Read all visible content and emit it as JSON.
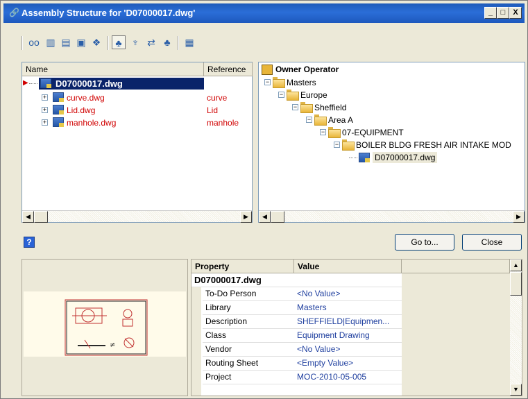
{
  "window": {
    "title": "Assembly Structure for 'D07000017.dwg'",
    "min_label": "_",
    "max_label": "□",
    "close_label": "X"
  },
  "toolbar": {
    "icons": [
      "glasses-icon",
      "columns-icon",
      "copy-icon",
      "export-icon",
      "link-icon",
      "tree-icon",
      "filter-icon",
      "compare-icon",
      "hierarchy-icon",
      "properties-icon"
    ],
    "glyphs": [
      "oo",
      "▥",
      "▤",
      "▣",
      "❖",
      "♣",
      "♆",
      "⇄",
      "♣",
      "▦"
    ]
  },
  "assembly": {
    "columns": {
      "name": "Name",
      "reference": "Reference"
    },
    "root": {
      "name": "D07000017.dwg",
      "reference": ""
    },
    "children": [
      {
        "name": "curve.dwg",
        "reference": "curve"
      },
      {
        "name": "Lid.dwg",
        "reference": "Lid"
      },
      {
        "name": "manhole.dwg",
        "reference": "manhole"
      }
    ],
    "child_color": "#d00000"
  },
  "tree": {
    "root": "Owner Operator",
    "nodes": [
      "Masters",
      "Europe",
      "Sheffield",
      "Area A",
      "07-EQUIPMENT",
      "BOILER BLDG FRESH AIR INTAKE MOD",
      "D07000017.dwg"
    ]
  },
  "buttons": {
    "goto": "Go to...",
    "close": "Close",
    "help": "?"
  },
  "properties": {
    "header": {
      "property": "Property",
      "value": "Value"
    },
    "group": "D07000017.dwg",
    "rows": [
      {
        "property": "To-Do Person",
        "value": "<No Value>"
      },
      {
        "property": "Library",
        "value": "Masters"
      },
      {
        "property": "Description",
        "value": "SHEFFIELD|Equipmen..."
      },
      {
        "property": "Class",
        "value": "Equipment Drawing"
      },
      {
        "property": "Vendor",
        "value": "<No Value>"
      },
      {
        "property": "Routing Sheet",
        "value": "<Empty Value>"
      },
      {
        "property": "Project",
        "value": "MOC-2010-05-005"
      }
    ],
    "value_color": "#1f3f9f"
  },
  "colors": {
    "title_bar": "#2b6ed8",
    "selection": "#0a246a",
    "chrome": "#ece9d8"
  }
}
